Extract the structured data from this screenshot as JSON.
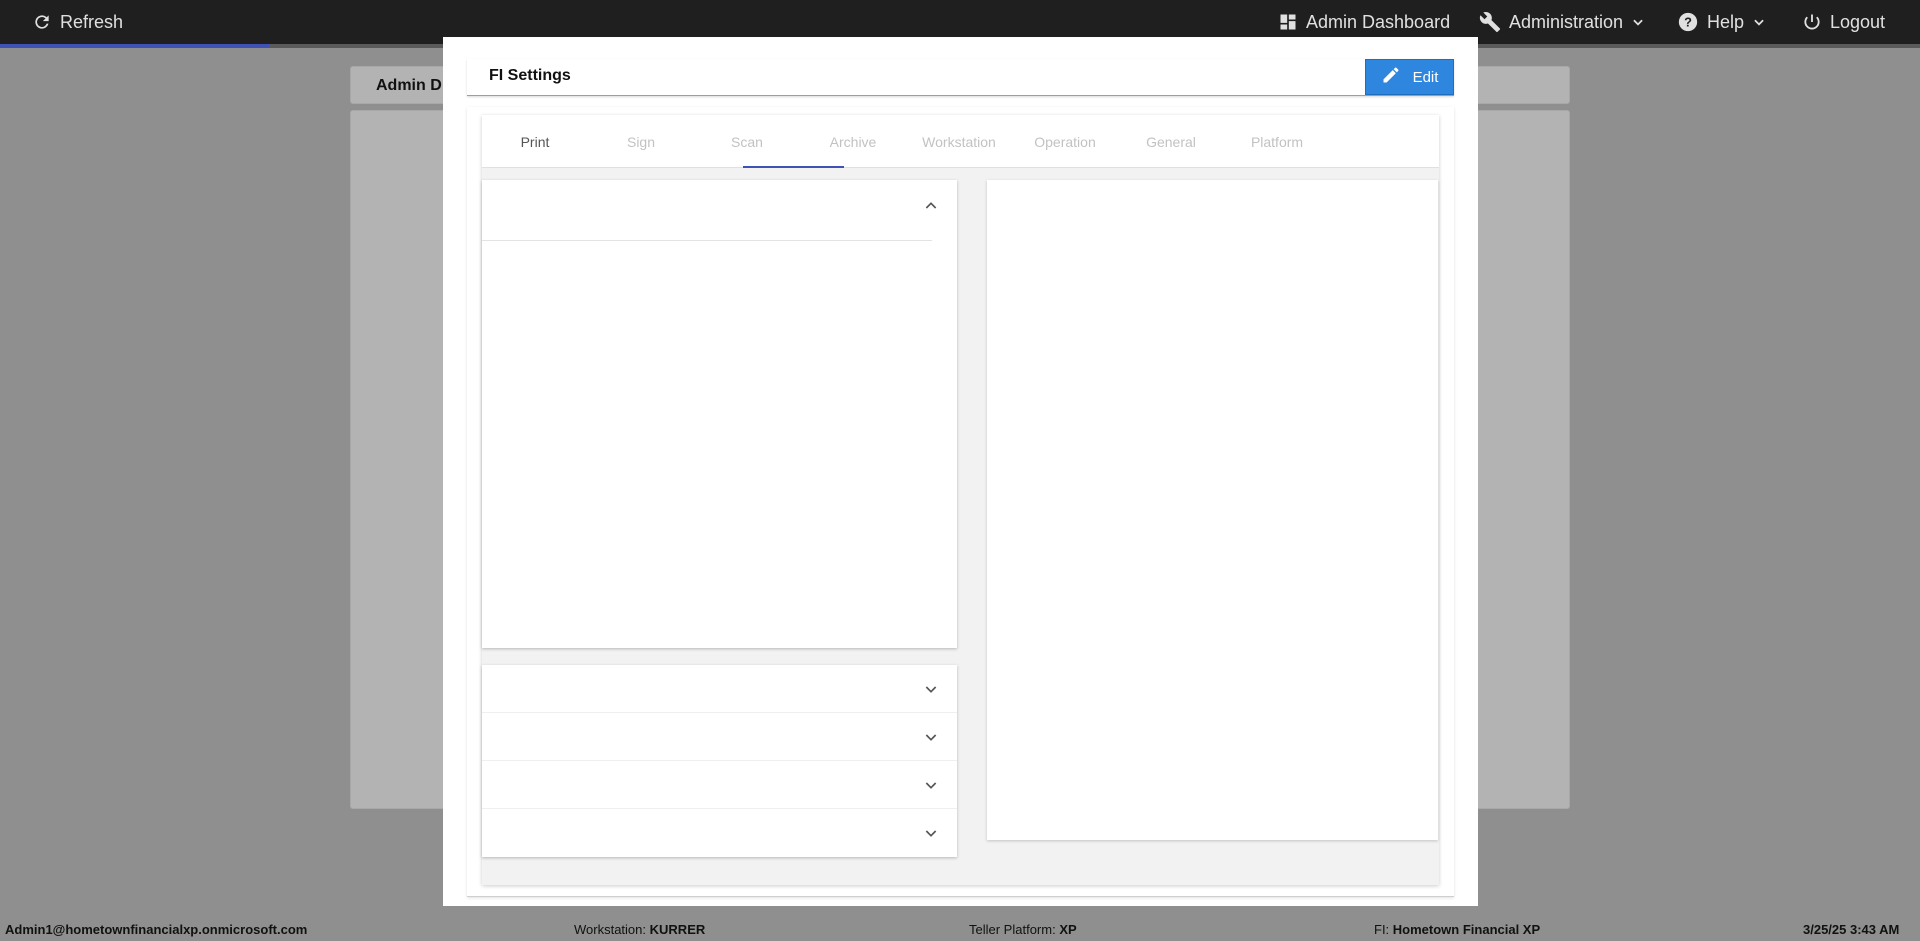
{
  "topbar": {
    "refresh_label": "Refresh",
    "admin_dashboard_label": "Admin Dashboard",
    "administration_label": "Administration",
    "help_label": "Help",
    "logout_label": "Logout",
    "loading_progress": 0.14
  },
  "background": {
    "header_title": "Admin D"
  },
  "modal": {
    "title": "FI Settings",
    "edit_label": "Edit",
    "tabs": [
      {
        "label": "Print"
      },
      {
        "label": "Sign"
      },
      {
        "label": "Scan"
      },
      {
        "label": "Archive"
      },
      {
        "label": "Workstation"
      },
      {
        "label": "Operation"
      },
      {
        "label": "General"
      },
      {
        "label": "Platform"
      }
    ],
    "accordion_count": 4
  },
  "statusbar": {
    "user": "Admin1@hometownfinancialxp.onmicrosoft.com",
    "workstation_label": "Workstation:",
    "workstation_value": "KURRER",
    "platform_label": "Teller Platform:",
    "platform_value": "XP",
    "fi_label": "FI:",
    "fi_value": "Hometown Financial XP",
    "datetime": "3/25/25 3:43 AM"
  },
  "colors": {
    "accent": "#3f51b5",
    "edit_button": "#2e86de",
    "topbar": "#1f1f1f",
    "overlay": "#8f8f8f"
  }
}
